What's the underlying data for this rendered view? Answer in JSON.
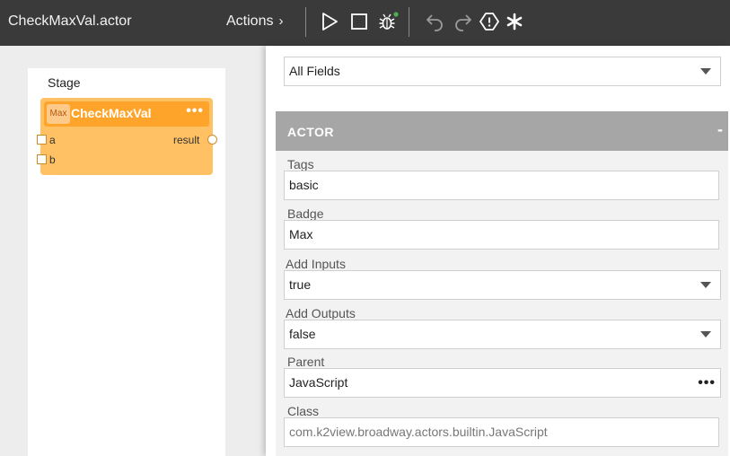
{
  "topbar": {
    "file_title": "CheckMaxVal.actor",
    "actions_label": "Actions",
    "icons": [
      "play-icon",
      "stop-icon",
      "debug-bug-icon",
      "undo-icon",
      "redo-icon",
      "validate-icon",
      "asterisk-icon"
    ],
    "debug_status_color": "#4caf50"
  },
  "stage": {
    "label": "Stage",
    "actor": {
      "badge": "Max",
      "name": "CheckMaxVal",
      "menu": "•••",
      "inputs": [
        "a",
        "b"
      ],
      "outputs": [
        "result"
      ],
      "colors": {
        "header": "#ffa42a",
        "body": "#ffc163"
      }
    }
  },
  "properties": {
    "filter": {
      "value": "All Fields"
    },
    "section": {
      "title": "ACTOR",
      "toggle": "-"
    },
    "fields": {
      "tags": {
        "label": "Tags",
        "value": "basic"
      },
      "badge": {
        "label": "Badge",
        "value": "Max"
      },
      "add_inputs": {
        "label": "Add Inputs",
        "value": "true"
      },
      "add_outputs": {
        "label": "Add Outputs",
        "value": "false"
      },
      "parent": {
        "label": "Parent",
        "value": "JavaScript",
        "more": "•••"
      },
      "class": {
        "label": "Class",
        "value": "com.k2view.broadway.actors.builtin.JavaScript"
      }
    }
  }
}
